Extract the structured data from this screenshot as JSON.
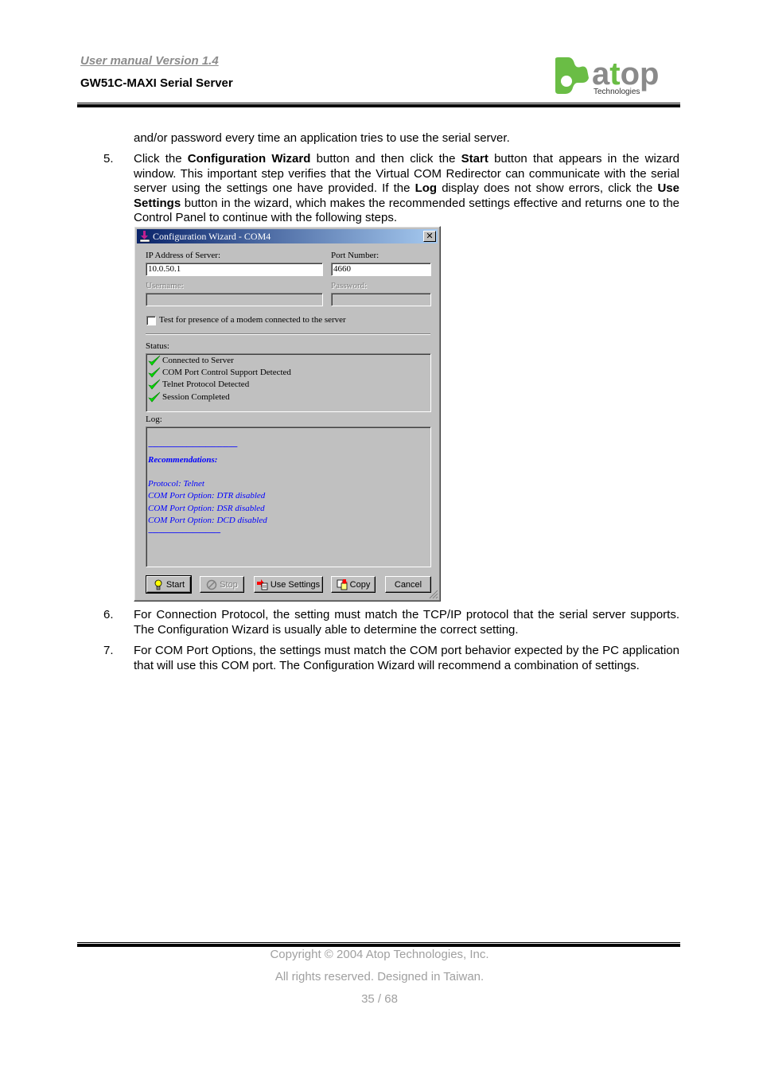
{
  "header": {
    "version": "User manual Version 1.4",
    "product": "GW51C-MAXI Serial Server",
    "logo": {
      "text": "atop",
      "subtext": "Technologies",
      "green": "#6abd45",
      "gray": "#8a8a8a"
    }
  },
  "body": {
    "intro_continuation": "and/or password every time an application tries to use the serial server.",
    "steps": [
      {
        "number": "5.",
        "parts": [
          "Click the ",
          "Configuration Wizard",
          " button and then click the ",
          "Start",
          " button that appears in the wizard window. This important step verifies that the Virtual COM Redirector can communicate with the serial server using the settings one have provided. If the ",
          "Log",
          " display does not show errors, click the ",
          "Use Settings",
          " button in the wizard, which makes the recommended settings effective and returns one to the Control Panel to continue with the following steps."
        ]
      },
      {
        "number": "6.",
        "text": "For Connection Protocol, the setting must match the TCP/IP protocol that the serial server supports.  The Configuration Wizard is usually able to determine the correct setting."
      },
      {
        "number": "7.",
        "text": "For COM Port Options, the settings must match the COM port behavior expected by the PC application that will use this COM port. The Configuration Wizard will recommend a combination of settings."
      }
    ]
  },
  "dialog": {
    "title": "Configuration Wizard - COM4",
    "close_label": "✕",
    "ip_label": "IP Address of Server:",
    "ip_value": "10.0.50.1",
    "port_label": "Port Number:",
    "port_value": "4660",
    "username_label": "Username:",
    "username_value": "",
    "password_label": "Password:",
    "password_value": "",
    "modem_checkbox_label": "Test for presence of a modem connected to the server",
    "modem_checked": false,
    "status_label": "Status:",
    "status_items": [
      "Connected to Server",
      "COM Port Control Support Detected",
      "Telnet Protocol Detected",
      "Session Completed"
    ],
    "log_label": "Log:",
    "log_lines": [
      "",
      "------------------------------------------",
      "Recommendations:",
      "",
      "Protocol: Telnet",
      "COM Port Option: DTR disabled",
      "COM Port Option: DSR disabled",
      "COM Port Option: DCD disabled",
      "----------------------------------"
    ],
    "buttons": {
      "start": "Start",
      "stop": "Stop",
      "use_settings": "Use Settings",
      "copy": "Copy",
      "cancel": "Cancel"
    }
  },
  "footer": {
    "copyright": "Copyright © 2004 Atop Technologies, Inc.",
    "rights": "All rights reserved. Designed in Taiwan.",
    "page": "35 / 68"
  }
}
